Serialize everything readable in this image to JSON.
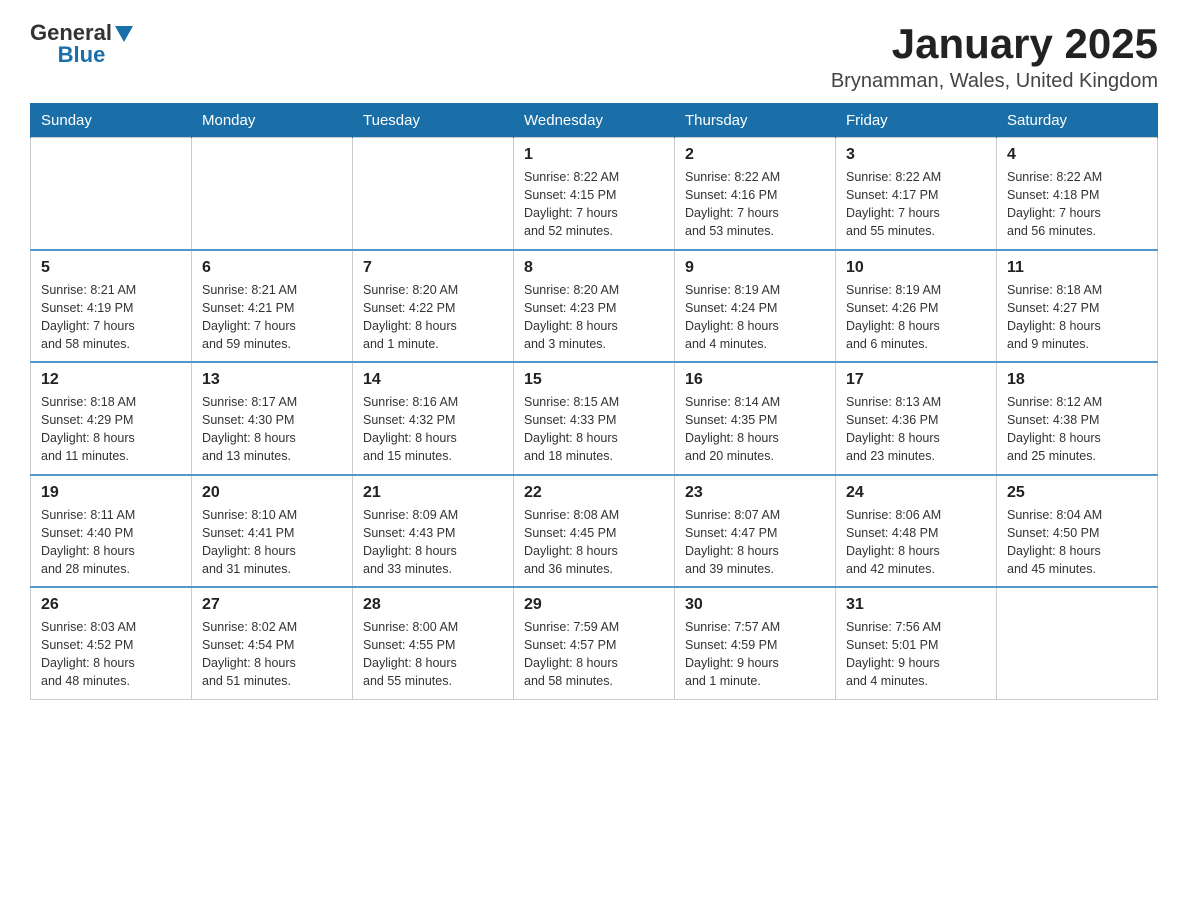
{
  "header": {
    "logo_general": "General",
    "logo_blue": "Blue",
    "month_title": "January 2025",
    "location": "Brynamman, Wales, United Kingdom"
  },
  "days_of_week": [
    "Sunday",
    "Monday",
    "Tuesday",
    "Wednesday",
    "Thursday",
    "Friday",
    "Saturday"
  ],
  "weeks": [
    [
      {
        "day": "",
        "info": ""
      },
      {
        "day": "",
        "info": ""
      },
      {
        "day": "",
        "info": ""
      },
      {
        "day": "1",
        "info": "Sunrise: 8:22 AM\nSunset: 4:15 PM\nDaylight: 7 hours\nand 52 minutes."
      },
      {
        "day": "2",
        "info": "Sunrise: 8:22 AM\nSunset: 4:16 PM\nDaylight: 7 hours\nand 53 minutes."
      },
      {
        "day": "3",
        "info": "Sunrise: 8:22 AM\nSunset: 4:17 PM\nDaylight: 7 hours\nand 55 minutes."
      },
      {
        "day": "4",
        "info": "Sunrise: 8:22 AM\nSunset: 4:18 PM\nDaylight: 7 hours\nand 56 minutes."
      }
    ],
    [
      {
        "day": "5",
        "info": "Sunrise: 8:21 AM\nSunset: 4:19 PM\nDaylight: 7 hours\nand 58 minutes."
      },
      {
        "day": "6",
        "info": "Sunrise: 8:21 AM\nSunset: 4:21 PM\nDaylight: 7 hours\nand 59 minutes."
      },
      {
        "day": "7",
        "info": "Sunrise: 8:20 AM\nSunset: 4:22 PM\nDaylight: 8 hours\nand 1 minute."
      },
      {
        "day": "8",
        "info": "Sunrise: 8:20 AM\nSunset: 4:23 PM\nDaylight: 8 hours\nand 3 minutes."
      },
      {
        "day": "9",
        "info": "Sunrise: 8:19 AM\nSunset: 4:24 PM\nDaylight: 8 hours\nand 4 minutes."
      },
      {
        "day": "10",
        "info": "Sunrise: 8:19 AM\nSunset: 4:26 PM\nDaylight: 8 hours\nand 6 minutes."
      },
      {
        "day": "11",
        "info": "Sunrise: 8:18 AM\nSunset: 4:27 PM\nDaylight: 8 hours\nand 9 minutes."
      }
    ],
    [
      {
        "day": "12",
        "info": "Sunrise: 8:18 AM\nSunset: 4:29 PM\nDaylight: 8 hours\nand 11 minutes."
      },
      {
        "day": "13",
        "info": "Sunrise: 8:17 AM\nSunset: 4:30 PM\nDaylight: 8 hours\nand 13 minutes."
      },
      {
        "day": "14",
        "info": "Sunrise: 8:16 AM\nSunset: 4:32 PM\nDaylight: 8 hours\nand 15 minutes."
      },
      {
        "day": "15",
        "info": "Sunrise: 8:15 AM\nSunset: 4:33 PM\nDaylight: 8 hours\nand 18 minutes."
      },
      {
        "day": "16",
        "info": "Sunrise: 8:14 AM\nSunset: 4:35 PM\nDaylight: 8 hours\nand 20 minutes."
      },
      {
        "day": "17",
        "info": "Sunrise: 8:13 AM\nSunset: 4:36 PM\nDaylight: 8 hours\nand 23 minutes."
      },
      {
        "day": "18",
        "info": "Sunrise: 8:12 AM\nSunset: 4:38 PM\nDaylight: 8 hours\nand 25 minutes."
      }
    ],
    [
      {
        "day": "19",
        "info": "Sunrise: 8:11 AM\nSunset: 4:40 PM\nDaylight: 8 hours\nand 28 minutes."
      },
      {
        "day": "20",
        "info": "Sunrise: 8:10 AM\nSunset: 4:41 PM\nDaylight: 8 hours\nand 31 minutes."
      },
      {
        "day": "21",
        "info": "Sunrise: 8:09 AM\nSunset: 4:43 PM\nDaylight: 8 hours\nand 33 minutes."
      },
      {
        "day": "22",
        "info": "Sunrise: 8:08 AM\nSunset: 4:45 PM\nDaylight: 8 hours\nand 36 minutes."
      },
      {
        "day": "23",
        "info": "Sunrise: 8:07 AM\nSunset: 4:47 PM\nDaylight: 8 hours\nand 39 minutes."
      },
      {
        "day": "24",
        "info": "Sunrise: 8:06 AM\nSunset: 4:48 PM\nDaylight: 8 hours\nand 42 minutes."
      },
      {
        "day": "25",
        "info": "Sunrise: 8:04 AM\nSunset: 4:50 PM\nDaylight: 8 hours\nand 45 minutes."
      }
    ],
    [
      {
        "day": "26",
        "info": "Sunrise: 8:03 AM\nSunset: 4:52 PM\nDaylight: 8 hours\nand 48 minutes."
      },
      {
        "day": "27",
        "info": "Sunrise: 8:02 AM\nSunset: 4:54 PM\nDaylight: 8 hours\nand 51 minutes."
      },
      {
        "day": "28",
        "info": "Sunrise: 8:00 AM\nSunset: 4:55 PM\nDaylight: 8 hours\nand 55 minutes."
      },
      {
        "day": "29",
        "info": "Sunrise: 7:59 AM\nSunset: 4:57 PM\nDaylight: 8 hours\nand 58 minutes."
      },
      {
        "day": "30",
        "info": "Sunrise: 7:57 AM\nSunset: 4:59 PM\nDaylight: 9 hours\nand 1 minute."
      },
      {
        "day": "31",
        "info": "Sunrise: 7:56 AM\nSunset: 5:01 PM\nDaylight: 9 hours\nand 4 minutes."
      },
      {
        "day": "",
        "info": ""
      }
    ]
  ]
}
